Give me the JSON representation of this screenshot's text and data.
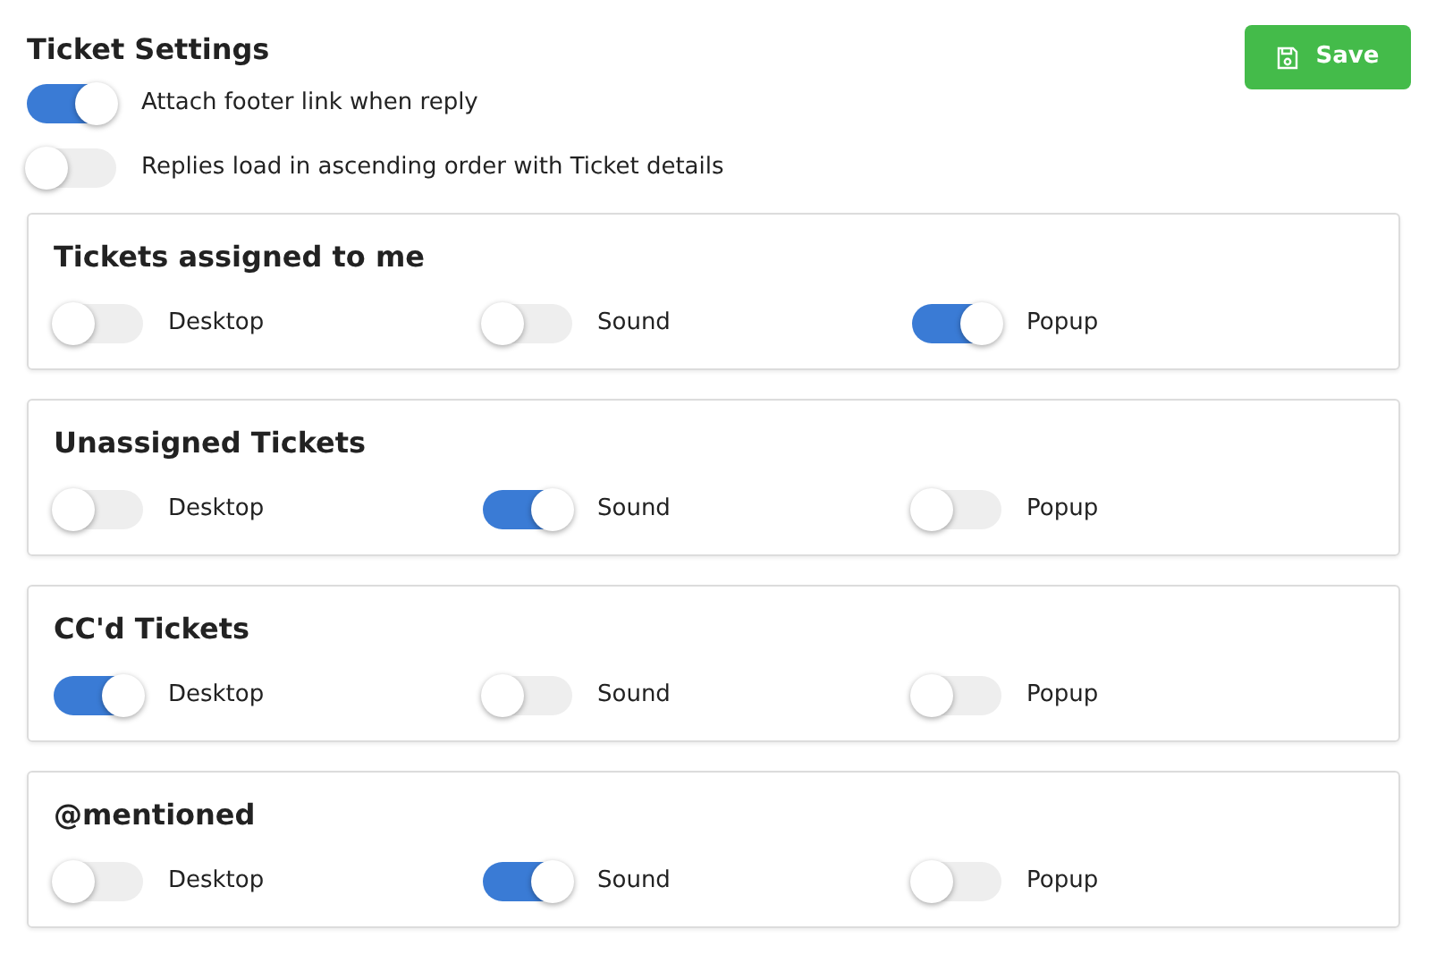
{
  "title": "Ticket Settings",
  "save_button": {
    "label": "Save"
  },
  "options": [
    {
      "label": "Attach footer link when reply",
      "on": true
    },
    {
      "label": "Replies load in ascending order with Ticket details",
      "on": false
    }
  ],
  "groups": [
    {
      "title": "Tickets assigned to me",
      "toggles": [
        {
          "label": "Desktop",
          "on": false
        },
        {
          "label": "Sound",
          "on": false
        },
        {
          "label": "Popup",
          "on": true
        }
      ]
    },
    {
      "title": "Unassigned Tickets",
      "toggles": [
        {
          "label": "Desktop",
          "on": false
        },
        {
          "label": "Sound",
          "on": true
        },
        {
          "label": "Popup",
          "on": false
        }
      ]
    },
    {
      "title": "CC'd Tickets",
      "toggles": [
        {
          "label": "Desktop",
          "on": true
        },
        {
          "label": "Sound",
          "on": false
        },
        {
          "label": "Popup",
          "on": false
        }
      ]
    },
    {
      "title": "@mentioned",
      "toggles": [
        {
          "label": "Desktop",
          "on": false
        },
        {
          "label": "Sound",
          "on": true
        },
        {
          "label": "Popup",
          "on": false
        }
      ]
    }
  ]
}
